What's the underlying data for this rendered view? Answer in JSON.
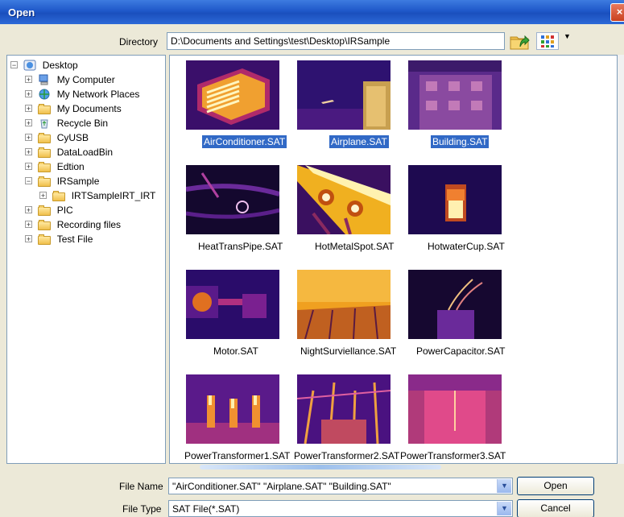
{
  "window": {
    "title": "Open",
    "close_glyph": "×"
  },
  "directory": {
    "label": "Directory",
    "value": "D:\\Documents and Settings\\test\\Desktop\\IRSample"
  },
  "tree": [
    {
      "label": "Desktop",
      "icon": "desktop-icon",
      "exp": "−"
    },
    {
      "label": "My Computer",
      "icon": "computer-icon",
      "exp": "+"
    },
    {
      "label": "My Network Places",
      "icon": "network-icon",
      "exp": "+"
    },
    {
      "label": "My Documents",
      "icon": "documents-icon",
      "exp": "+"
    },
    {
      "label": "Recycle Bin",
      "icon": "recycle-bin-icon",
      "exp": "+"
    },
    {
      "label": "CyUSB",
      "icon": "folder-icon",
      "exp": "+"
    },
    {
      "label": "DataLoadBin",
      "icon": "folder-icon",
      "exp": "+"
    },
    {
      "label": "Edtion",
      "icon": "folder-icon",
      "exp": "+"
    },
    {
      "label": "IRSample",
      "icon": "folder-open-icon",
      "exp": "−"
    },
    {
      "label": "IRTSampleIRT_IRT",
      "icon": "folder-icon",
      "exp": "+"
    },
    {
      "label": "PIC",
      "icon": "folder-icon",
      "exp": "+"
    },
    {
      "label": "Recording files",
      "icon": "folder-icon",
      "exp": "+"
    },
    {
      "label": "Test File",
      "icon": "folder-icon",
      "exp": "+"
    }
  ],
  "files": [
    {
      "name": "AirConditioner.SAT",
      "selected": true
    },
    {
      "name": "Airplane.SAT",
      "selected": true
    },
    {
      "name": "Building.SAT",
      "selected": true
    },
    {
      "name": "HeatTransPipe.SAT",
      "selected": false
    },
    {
      "name": "HotMetalSpot.SAT",
      "selected": false
    },
    {
      "name": "HotwaterCup.SAT",
      "selected": false
    },
    {
      "name": "Motor.SAT",
      "selected": false
    },
    {
      "name": "NightSurviellance.SAT",
      "selected": false
    },
    {
      "name": "PowerCapacitor.SAT",
      "selected": false
    },
    {
      "name": "PowerTransformer1.SAT",
      "selected": false
    },
    {
      "name": "PowerTransformer2.SAT",
      "selected": false
    },
    {
      "name": "PowerTransformer3.SAT",
      "selected": false
    }
  ],
  "file_name": {
    "label": "File Name",
    "value": "\"AirConditioner.SAT\" \"Airplane.SAT\" \"Building.SAT\""
  },
  "file_type": {
    "label": "File Type",
    "value": "SAT File(*.SAT)"
  },
  "buttons": {
    "open": "Open",
    "cancel": "Cancel"
  },
  "colors": {
    "title_bar": "#1f58c9",
    "selection": "#3169c6",
    "dialog_bg": "#ece9d8"
  }
}
